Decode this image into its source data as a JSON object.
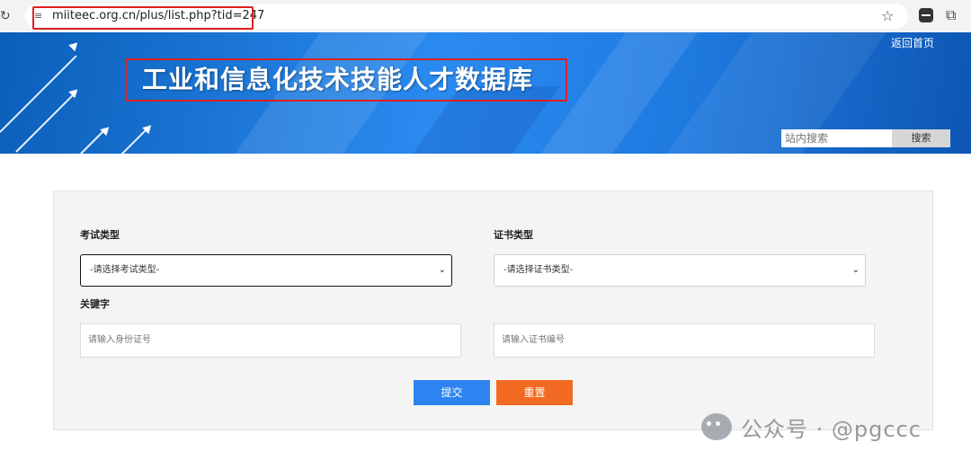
{
  "browser": {
    "url": "miiteec.org.cn/plus/list.php?tid=247",
    "reload_icon": "reload-icon",
    "site_info_icon": "site-info-icon",
    "bookmark_icon": "star-icon",
    "extension_icons": [
      "extension-app-icon",
      "puzzle-icon"
    ]
  },
  "header": {
    "home_link": "返回首页",
    "site_title": "工业和信息化技术技能人才数据库",
    "search": {
      "placeholder": "站内搜索",
      "button_label": "搜索"
    }
  },
  "form": {
    "exam_type_label": "考试类型",
    "exam_type_value": "-请选择考试类型-",
    "cert_type_label": "证书类型",
    "cert_type_value": "-请选择证书类型-",
    "keyword_label": "关键字",
    "id_placeholder": "请输入身份证号",
    "cert_no_placeholder": "请输入证书编号",
    "submit_label": "提交",
    "reset_label": "重置"
  },
  "watermark": {
    "text": "公众号 · @pgccc"
  },
  "colors": {
    "banner_blue": "#1f7ae0",
    "submit_blue": "#2d84f0",
    "reset_orange": "#f26a22",
    "highlight_red": "#e02020"
  }
}
